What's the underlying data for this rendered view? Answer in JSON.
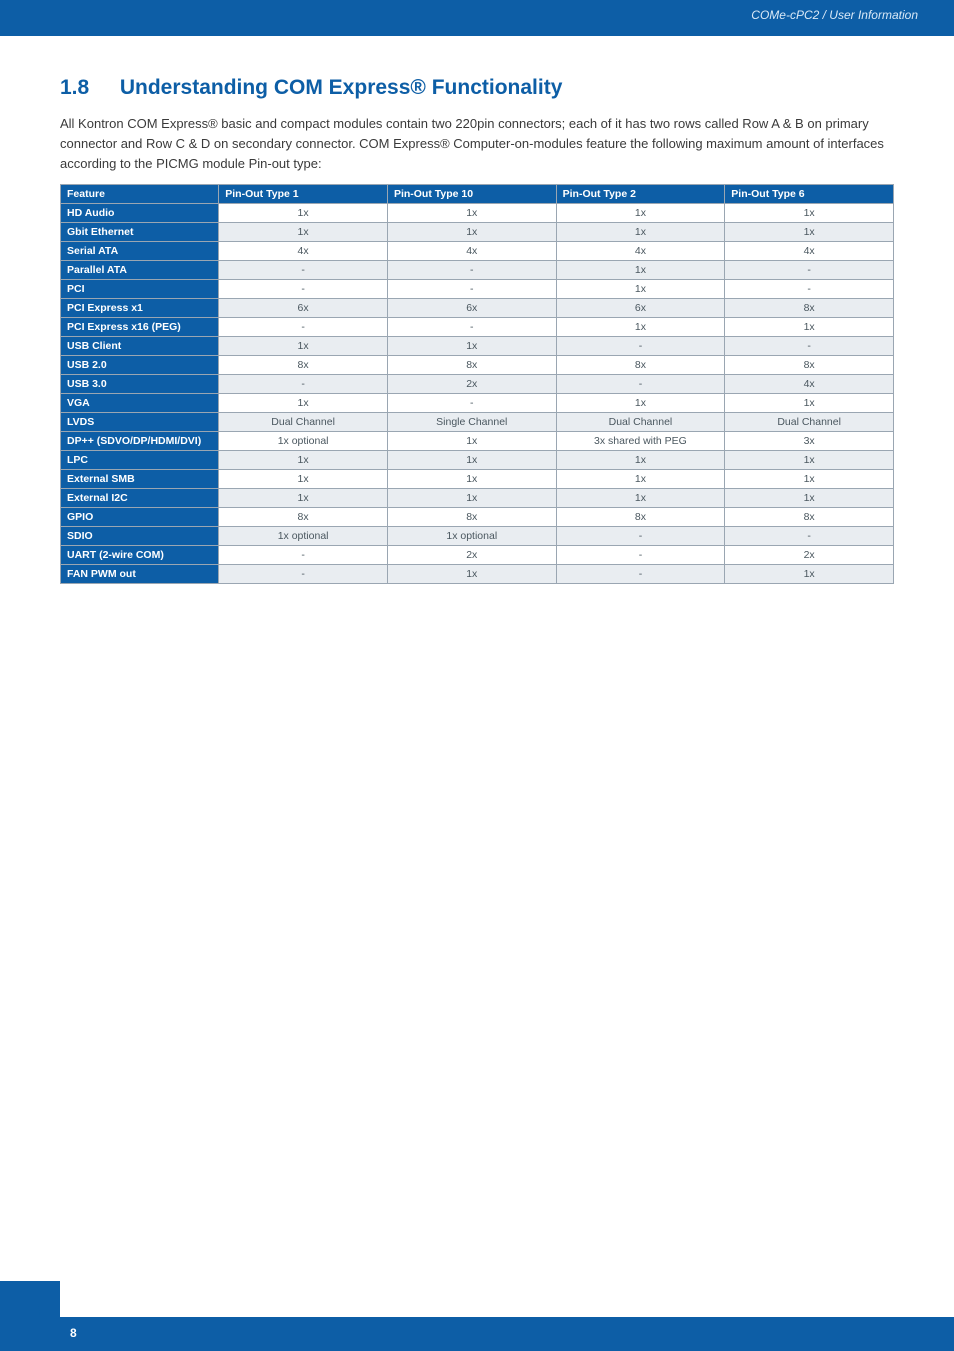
{
  "header": {
    "breadcrumb": "COMe-cPC2 / User Information"
  },
  "section": {
    "number": "1.8",
    "title": "Understanding COM Express® Functionality",
    "paragraph": "All Kontron COM Express® basic and compact modules contain two 220pin connectors; each of it has two rows called Row A & B on primary connector and Row C & D on secondary connector. COM Express® Computer-on-modules feature the following maximum amount of interfaces according to the PICMG module Pin-out type:"
  },
  "table": {
    "headers": [
      "Feature",
      "Pin-Out Type 1",
      "Pin-Out Type 10",
      "Pin-Out Type 2",
      "Pin-Out Type 6"
    ],
    "rows": [
      {
        "feature": "HD Audio",
        "t1": "1x",
        "t10": "1x",
        "t2": "1x",
        "t6": "1x"
      },
      {
        "feature": "Gbit Ethernet",
        "t1": "1x",
        "t10": "1x",
        "t2": "1x",
        "t6": "1x"
      },
      {
        "feature": "Serial ATA",
        "t1": "4x",
        "t10": "4x",
        "t2": "4x",
        "t6": "4x"
      },
      {
        "feature": "Parallel ATA",
        "t1": "-",
        "t10": "-",
        "t2": "1x",
        "t6": "-"
      },
      {
        "feature": "PCI",
        "t1": "-",
        "t10": "-",
        "t2": "1x",
        "t6": "-"
      },
      {
        "feature": "PCI Express x1",
        "t1": "6x",
        "t10": "6x",
        "t2": "6x",
        "t6": "8x"
      },
      {
        "feature": "PCI Express x16 (PEG)",
        "t1": "-",
        "t10": "-",
        "t2": "1x",
        "t6": "1x"
      },
      {
        "feature": "USB Client",
        "t1": "1x",
        "t10": "1x",
        "t2": "-",
        "t6": "-"
      },
      {
        "feature": "USB 2.0",
        "t1": "8x",
        "t10": "8x",
        "t2": "8x",
        "t6": "8x"
      },
      {
        "feature": "USB 3.0",
        "t1": "-",
        "t10": "2x",
        "t2": "-",
        "t6": "4x"
      },
      {
        "feature": "VGA",
        "t1": "1x",
        "t10": "-",
        "t2": "1x",
        "t6": "1x"
      },
      {
        "feature": "LVDS",
        "t1": "Dual Channel",
        "t10": "Single Channel",
        "t2": "Dual Channel",
        "t6": "Dual Channel"
      },
      {
        "feature": "DP++ (SDVO/DP/HDMI/DVI)",
        "t1": "1x optional",
        "t10": "1x",
        "t2": "3x shared with PEG",
        "t6": "3x"
      },
      {
        "feature": "LPC",
        "t1": "1x",
        "t10": "1x",
        "t2": "1x",
        "t6": "1x"
      },
      {
        "feature": "External SMB",
        "t1": "1x",
        "t10": "1x",
        "t2": "1x",
        "t6": "1x"
      },
      {
        "feature": "External I2C",
        "t1": "1x",
        "t10": "1x",
        "t2": "1x",
        "t6": "1x"
      },
      {
        "feature": "GPIO",
        "t1": "8x",
        "t10": "8x",
        "t2": "8x",
        "t6": "8x"
      },
      {
        "feature": "SDIO",
        "t1": "1x optional",
        "t10": "1x optional",
        "t2": "-",
        "t6": "-"
      },
      {
        "feature": "UART (2-wire COM)",
        "t1": "-",
        "t10": "2x",
        "t2": "-",
        "t6": "2x"
      },
      {
        "feature": "FAN PWM out",
        "t1": "-",
        "t10": "1x",
        "t2": "-",
        "t6": "1x"
      }
    ]
  },
  "footer": {
    "page": "8"
  }
}
